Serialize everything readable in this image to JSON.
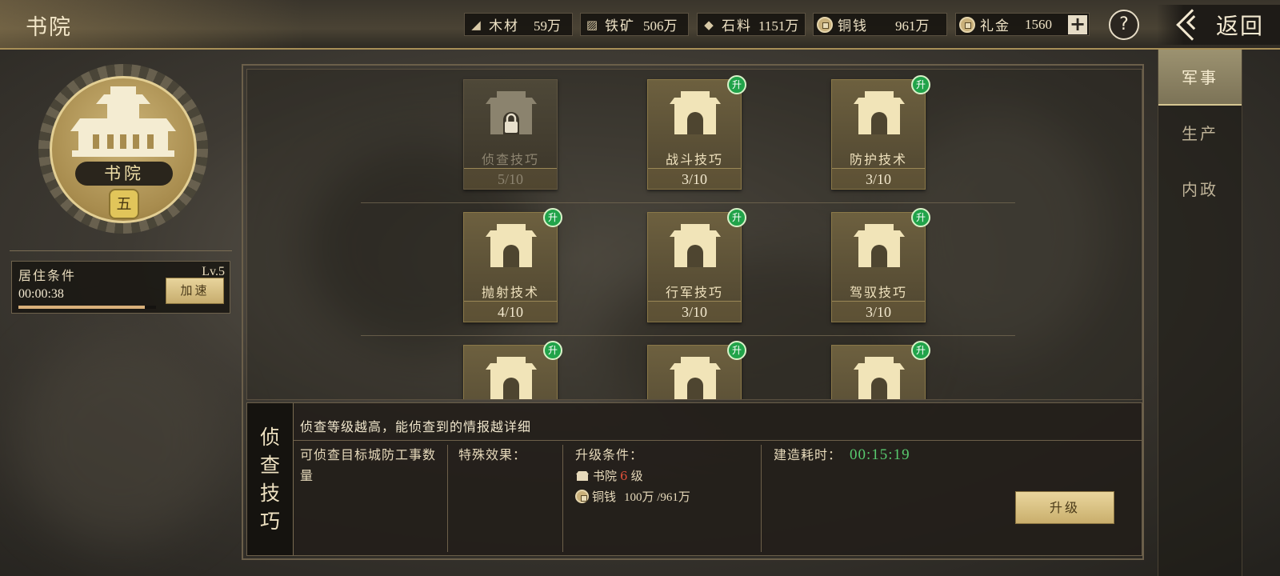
{
  "page": {
    "title": "书院"
  },
  "resources": [
    {
      "name": "木材",
      "value": "59万",
      "icon": "wood-icon"
    },
    {
      "name": "铁矿",
      "value": "506万",
      "icon": "iron-ore-icon"
    },
    {
      "name": "石料",
      "value": "1151万",
      "icon": "stone-icon"
    },
    {
      "name": "铜钱",
      "value": "961万",
      "icon": "copper-coin-icon"
    },
    {
      "name": "礼金",
      "value": "1560",
      "icon": "gift-money-icon"
    }
  ],
  "header": {
    "plus_label": "+",
    "help_label": "?",
    "back_label": "返回"
  },
  "building": {
    "name": "书院",
    "level_badge": "五"
  },
  "residence": {
    "label": "居住条件",
    "level": "Lv.5",
    "timer": "00:00:38",
    "progress": 0.92,
    "speed_label": "加速"
  },
  "techs": [
    {
      "name": "侦查技巧",
      "level": "5/10",
      "locked": true,
      "upgradable": false
    },
    {
      "name": "战斗技巧",
      "level": "3/10",
      "locked": false,
      "upgradable": true
    },
    {
      "name": "防护技术",
      "level": "3/10",
      "locked": false,
      "upgradable": true
    },
    {
      "name": "抛射技术",
      "level": "4/10",
      "locked": false,
      "upgradable": true
    },
    {
      "name": "行军技巧",
      "level": "3/10",
      "locked": false,
      "upgradable": true
    },
    {
      "name": "驾驭技巧",
      "level": "3/10",
      "locked": false,
      "upgradable": true
    },
    {
      "name": "",
      "level": "",
      "locked": false,
      "upgradable": true
    },
    {
      "name": "",
      "level": "",
      "locked": false,
      "upgradable": true
    },
    {
      "name": "",
      "level": "",
      "locked": false,
      "upgradable": true
    }
  ],
  "upgrade_badge": "升",
  "detail": {
    "title_chars": [
      "侦",
      "查",
      "技",
      "巧"
    ],
    "description": "侦查等级越高，能侦查到的情报越详细",
    "effect_text": "可侦查目标城防工事数量",
    "special_label": "特殊效果：",
    "conditions_label": "升级条件：",
    "req_building_name": "书院",
    "req_building_level": "6",
    "req_building_suffix": "级",
    "req_coin_name": "铜钱",
    "req_coin_value": "100万 /961万",
    "build_time_label": "建造耗时：",
    "build_time": "00:15:19",
    "upgrade_label": "升级"
  },
  "tabs": [
    {
      "label": "军事",
      "active": true
    },
    {
      "label": "生产",
      "active": false
    },
    {
      "label": "内政",
      "active": false
    }
  ],
  "colors": {
    "gold": "#c9ae6c",
    "badge_green": "#21a34a",
    "timer_green": "#58c96e",
    "req_red": "#e0503a"
  }
}
